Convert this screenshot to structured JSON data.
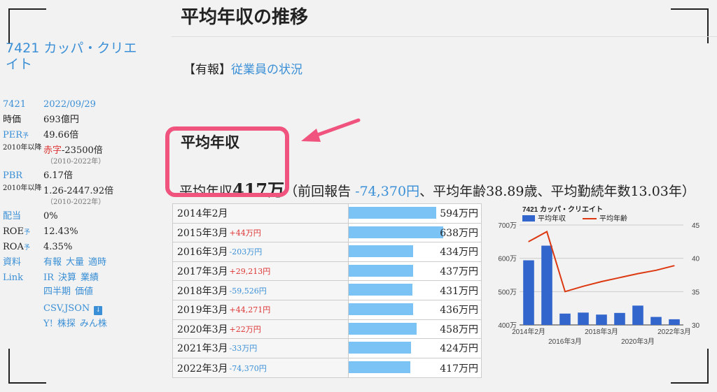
{
  "page": {
    "title": "平均年収の推移",
    "source_prefix": "【有報】",
    "source_link": "従業員の状況",
    "section_title": "平均年収"
  },
  "company": {
    "name": "7421 カッパ・クリエイト"
  },
  "sidebar": {
    "code": "7421",
    "date": "2022/09/29",
    "market_cap_label": "時価",
    "market_cap": "693億円",
    "per_label": "PER",
    "per_yo": "予",
    "per": "49.66倍",
    "per_hist_label": "2010年以降",
    "per_hist_red": "赤字",
    "per_hist": "-23500倍",
    "per_hist_sub": "（2010-2022年）",
    "pbr_label": "PBR",
    "pbr": "6.17倍",
    "pbr_hist_label": "2010年以降",
    "pbr_hist": "1.26-2447.92倍",
    "pbr_hist_sub": "（2010-2022年）",
    "div_label": "配当",
    "div": "0%",
    "roe_label": "ROE",
    "roe_yo": "予",
    "roe": "12.43%",
    "roa_label": "ROA",
    "roa_yo": "予",
    "roa": "4.35%",
    "docs_label": "資料",
    "docs": [
      "有報",
      "大量",
      "適時"
    ],
    "link_label": "Link",
    "links_1": [
      "IR",
      "決算",
      "業績"
    ],
    "links_2": [
      "四半期",
      "価値"
    ],
    "links_3": "CSV,JSON",
    "links_4": [
      "Y!",
      "株探",
      "みん株"
    ]
  },
  "summary": {
    "prefix": "平均年収",
    "amount": "417万",
    "open": "（前回報告 ",
    "diff": "-74,370円",
    "rest": "、平均年齢38.89歳、平均勤続年数13.03年）"
  },
  "table": {
    "rows": [
      {
        "label": "2014年2月",
        "diff": "",
        "sign": "",
        "value": "594万円",
        "amount": 594
      },
      {
        "label": "2015年3月",
        "diff": "+44万円",
        "sign": "pos",
        "value": "638万円",
        "amount": 638
      },
      {
        "label": "2016年3月",
        "diff": "-203万円",
        "sign": "neg",
        "value": "434万円",
        "amount": 434
      },
      {
        "label": "2017年3月",
        "diff": "+29,213円",
        "sign": "pos",
        "value": "437万円",
        "amount": 437
      },
      {
        "label": "2018年3月",
        "diff": "-59,526円",
        "sign": "neg",
        "value": "431万円",
        "amount": 431
      },
      {
        "label": "2019年3月",
        "diff": "+44,271円",
        "sign": "pos",
        "value": "436万円",
        "amount": 436
      },
      {
        "label": "2020年3月",
        "diff": "+22万円",
        "sign": "pos",
        "value": "458万円",
        "amount": 458
      },
      {
        "label": "2021年3月",
        "diff": "-33万円",
        "sign": "neg",
        "value": "424万円",
        "amount": 424
      },
      {
        "label": "2022年3月",
        "diff": "-74,370円",
        "sign": "neg",
        "value": "417万円",
        "amount": 417
      }
    ]
  },
  "chart_data": {
    "type": "bar",
    "title": "7421 カッパ・クリエイト",
    "categories": [
      "2014年2月",
      "2015年3月",
      "2016年3月",
      "2017年3月",
      "2018年3月",
      "2019年3月",
      "2020年3月",
      "2021年3月",
      "2022年3月"
    ],
    "series": [
      {
        "name": "平均年収",
        "type": "bar",
        "axis": "left",
        "color": "#3366cc",
        "values": [
          594,
          638,
          434,
          437,
          431,
          436,
          458,
          424,
          417
        ]
      },
      {
        "name": "平均年齢",
        "type": "line",
        "axis": "right",
        "color": "#dc3912",
        "values": [
          42.5,
          44.0,
          35.0,
          35.8,
          36.5,
          37.1,
          37.7,
          38.2,
          38.89
        ]
      }
    ],
    "ylim_left": [
      400,
      700
    ],
    "ylim_right": [
      30,
      45
    ],
    "yticks_left": [
      "400万",
      "500万",
      "600万",
      "700万"
    ],
    "yticks_right": [
      "30",
      "35",
      "40",
      "45"
    ],
    "xtick_labels_top": [
      "2014年2月",
      "2018年3月",
      "2022年3月"
    ],
    "xtick_labels_bottom": [
      "2016年3月",
      "2020年3月"
    ],
    "legend_position": "top-left",
    "grid": true
  }
}
